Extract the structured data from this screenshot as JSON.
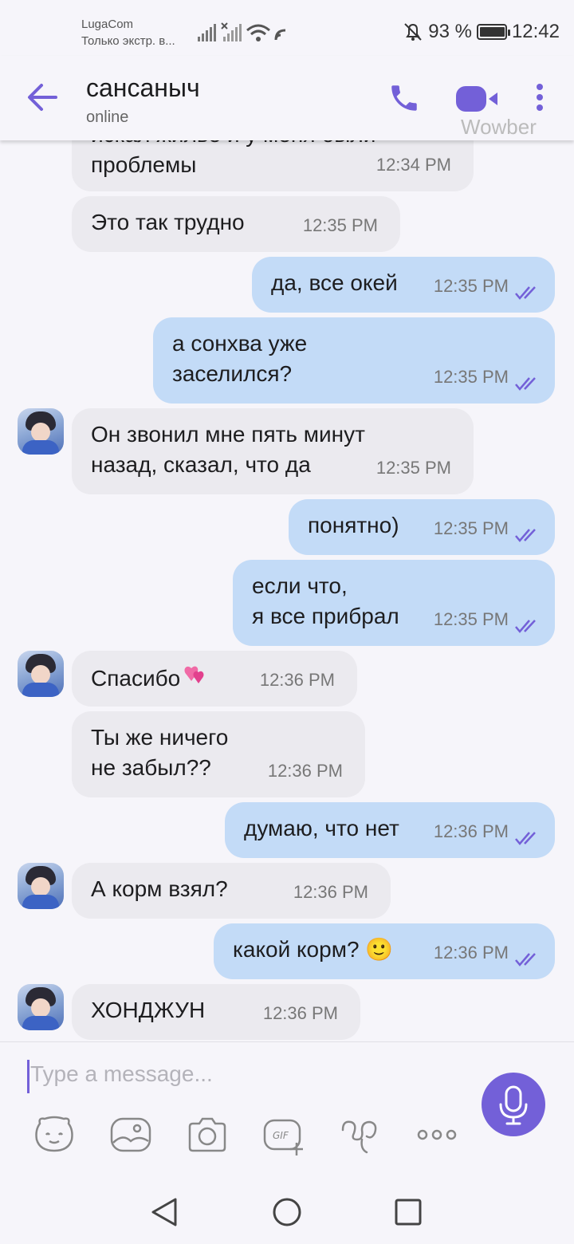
{
  "status_bar": {
    "carrier_name": "LugaCom",
    "carrier_sub": "Только экстр. в...",
    "battery_percent": "93 %",
    "battery_level": 0.93,
    "time": "12:42"
  },
  "header": {
    "contact_name": "сансаныч",
    "contact_status": "online",
    "watermark": "Wowber",
    "accent_color": "#7360d8"
  },
  "messages": [
    {
      "dir": "in",
      "text_lines": [
        "искал жилье и у меня были",
        "проблемы"
      ],
      "time": "12:34 PM",
      "avatar": false
    },
    {
      "dir": "in",
      "text_lines": [
        "Это так трудно"
      ],
      "time": "12:35 PM",
      "avatar": false
    },
    {
      "dir": "out",
      "text_lines": [
        "да, все окей"
      ],
      "time": "12:35 PM"
    },
    {
      "dir": "out",
      "text_lines": [
        "а сонхва уже",
        "заселился?"
      ],
      "time": "12:35 PM"
    },
    {
      "dir": "in",
      "text_lines": [
        "Он звонил мне пять минут",
        "назад, сказал, что да"
      ],
      "time": "12:35 PM",
      "avatar": true
    },
    {
      "dir": "out",
      "text_lines": [
        "понятно)"
      ],
      "time": "12:35 PM"
    },
    {
      "dir": "out",
      "text_lines": [
        "если что,",
        "я все прибрал"
      ],
      "time": "12:35 PM"
    },
    {
      "dir": "in",
      "text_lines": [
        "Спасибо"
      ],
      "time": "12:36 PM",
      "avatar": true,
      "emoji": "heart-emoji"
    },
    {
      "dir": "in",
      "text_lines": [
        "Ты же ничего",
        "не забыл??"
      ],
      "time": "12:36 PM",
      "avatar": false
    },
    {
      "dir": "out",
      "text_lines": [
        "думаю, что нет"
      ],
      "time": "12:36 PM"
    },
    {
      "dir": "in",
      "text_lines": [
        "А корм взял?"
      ],
      "time": "12:36 PM",
      "avatar": true
    },
    {
      "dir": "out",
      "text_lines": [
        "какой корм? 🙂"
      ],
      "time": "12:36 PM"
    },
    {
      "dir": "in",
      "text_lines": [
        "ХОНДЖУН"
      ],
      "time": "12:36 PM",
      "avatar": true
    }
  ],
  "composer": {
    "placeholder": "Type a message..."
  },
  "toolbar_icons": [
    "sticker-icon",
    "gallery-icon",
    "camera-icon",
    "gif-icon",
    "doodle-icon",
    "more-icon"
  ],
  "nav_icons": [
    "back-nav-icon",
    "home-nav-icon",
    "recents-nav-icon"
  ]
}
